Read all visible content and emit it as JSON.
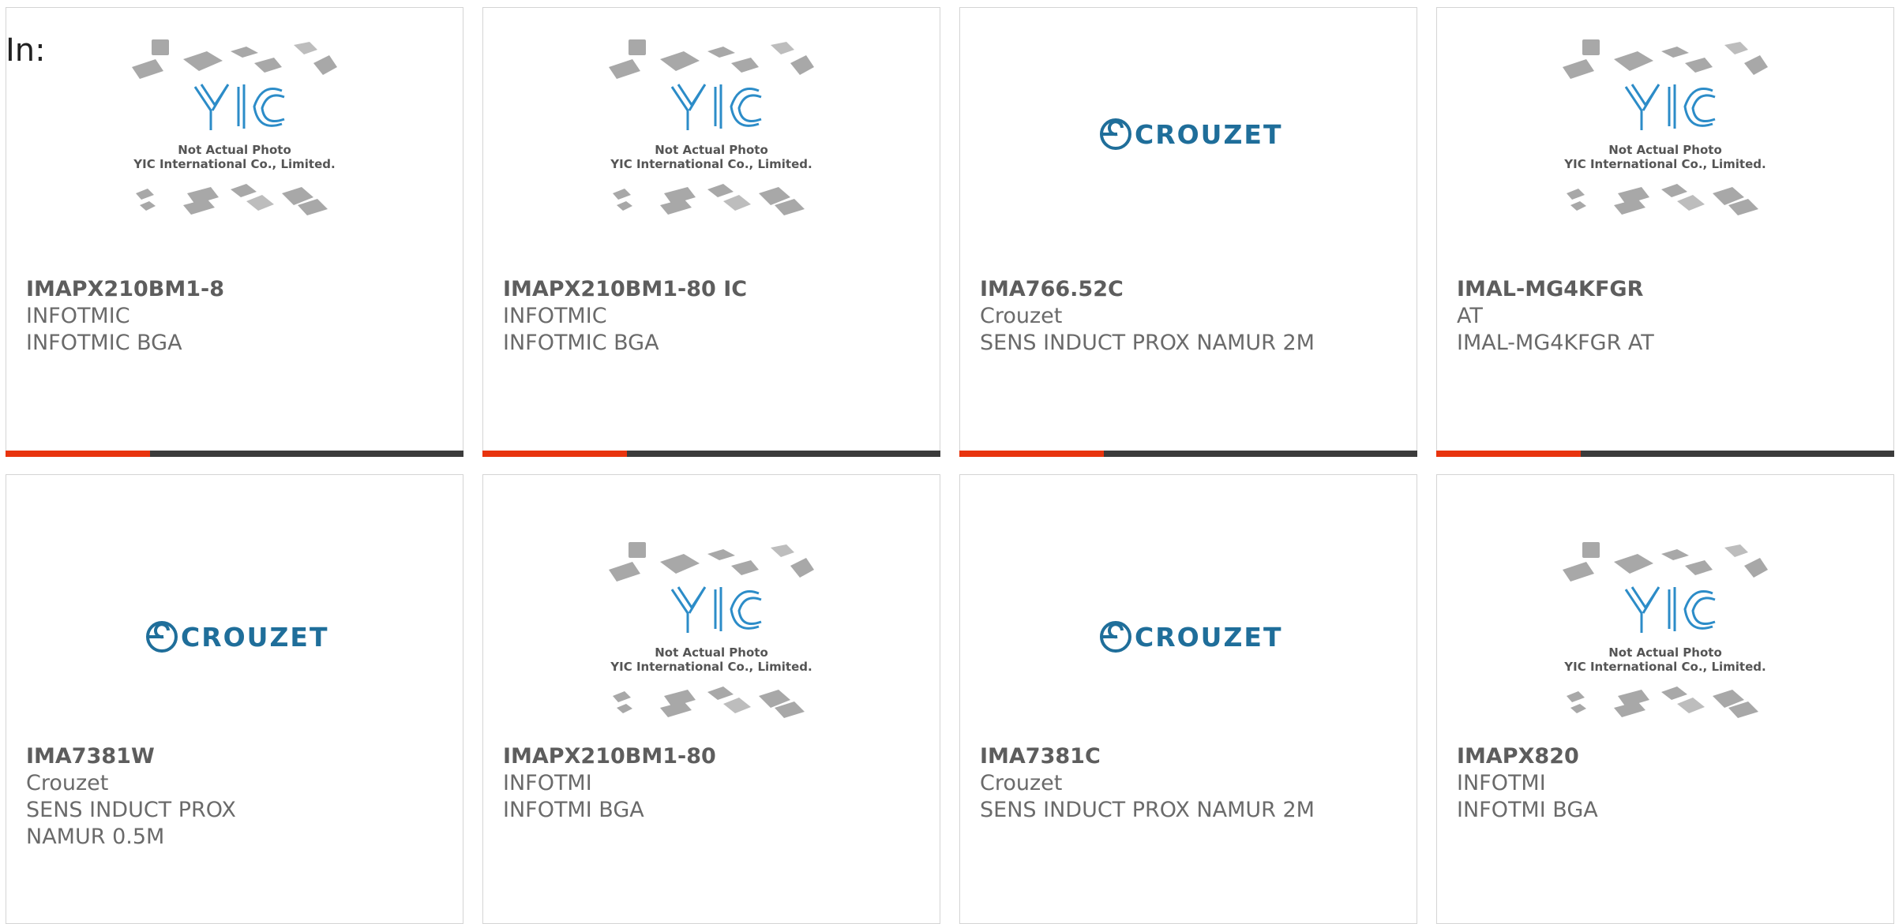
{
  "page_label": "In:",
  "placeholder_image": {
    "logo_text": "YIC",
    "caption_line1": "Not Actual Photo",
    "caption_line2": "YIC International Co., Limited."
  },
  "brand_logo": {
    "text": "CROUZET",
    "color": "#1f6e9a"
  },
  "colors": {
    "accent": "#e8340e",
    "bar_dark": "#3b3b3b",
    "text": "#6a6a6a",
    "border": "#d4d4d4"
  },
  "products": [
    {
      "part": "IMAPX210BM1-8",
      "manufacturer": "INFOTMIC",
      "description": "INFOTMIC BGA",
      "image": "yic-placeholder"
    },
    {
      "part": "IMAPX210BM1-80 IC",
      "manufacturer": "INFOTMIC",
      "description": "INFOTMIC BGA",
      "image": "yic-placeholder"
    },
    {
      "part": "IMA766.52C",
      "manufacturer": "Crouzet",
      "description": "SENS INDUCT PROX NAMUR 2M",
      "image": "crouzet-logo"
    },
    {
      "part": "IMAL-MG4KFGR",
      "manufacturer": "AT",
      "description": "IMAL-MG4KFGR AT",
      "image": "yic-placeholder"
    },
    {
      "part": "IMA7381W",
      "manufacturer": "Crouzet",
      "description": "SENS INDUCT PROX NAMUR 0.5M",
      "image": "crouzet-logo"
    },
    {
      "part": "IMAPX210BM1-80",
      "manufacturer": "INFOTMI",
      "description": "INFOTMI BGA",
      "image": "yic-placeholder"
    },
    {
      "part": "IMA7381C",
      "manufacturer": "Crouzet",
      "description": "SENS INDUCT PROX NAMUR 2M",
      "image": "crouzet-logo"
    },
    {
      "part": "IMAPX820",
      "manufacturer": "INFOTMI",
      "description": "INFOTMI BGA",
      "image": "yic-placeholder"
    }
  ]
}
